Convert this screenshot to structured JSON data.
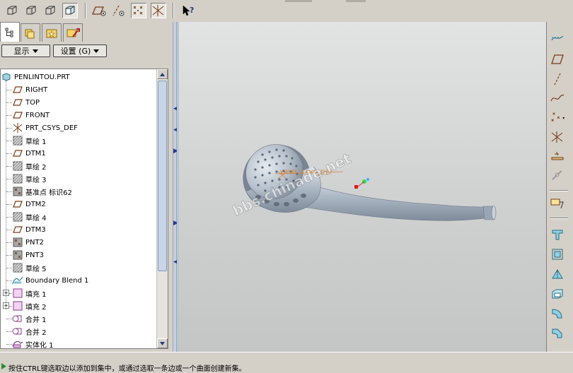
{
  "toolbar": {
    "buttons": [
      {
        "name": "datum-display-icon"
      },
      {
        "name": "hidden-line-icon"
      },
      {
        "name": "no-hidden-icon"
      },
      {
        "name": "shading-icon"
      },
      {
        "name": "plane-display-icon"
      },
      {
        "name": "axis-display-icon"
      },
      {
        "name": "point-display-icon"
      },
      {
        "name": "csys-display-icon"
      },
      {
        "name": "context-help-icon"
      }
    ]
  },
  "panel": {
    "tabs": [
      "model-tree-tab",
      "layer-tree-tab",
      "favorites-tab",
      "connections-tab"
    ],
    "show_label": "显示",
    "settings_label": "设置 (G)"
  },
  "tree": {
    "root": "PENLINTOU.PRT",
    "items": [
      {
        "label": "RIGHT",
        "icon": "plane-icon",
        "expandable": false
      },
      {
        "label": "TOP",
        "icon": "plane-icon",
        "expandable": false
      },
      {
        "label": "FRONT",
        "icon": "plane-icon",
        "expandable": false
      },
      {
        "label": "PRT_CSYS_DEF",
        "icon": "csys-icon",
        "expandable": false
      },
      {
        "label": "草绘 1",
        "icon": "sketch-icon",
        "expandable": false
      },
      {
        "label": "DTM1",
        "icon": "plane-icon",
        "expandable": false
      },
      {
        "label": "草绘 2",
        "icon": "sketch-icon",
        "expandable": false
      },
      {
        "label": "草绘 3",
        "icon": "sketch-icon",
        "expandable": false
      },
      {
        "label": "基准点 标识62",
        "icon": "datum-point-icon",
        "expandable": false
      },
      {
        "label": "DTM2",
        "icon": "plane-icon",
        "expandable": false
      },
      {
        "label": "草绘 4",
        "icon": "sketch-icon",
        "expandable": false
      },
      {
        "label": "DTM3",
        "icon": "plane-icon",
        "expandable": false
      },
      {
        "label": "PNT2",
        "icon": "datum-point-icon",
        "expandable": false
      },
      {
        "label": "PNT3",
        "icon": "datum-point-icon",
        "expandable": false
      },
      {
        "label": "草绘 5",
        "icon": "sketch-icon",
        "expandable": false
      },
      {
        "label": "Boundary Blend 1",
        "icon": "boundary-blend-icon",
        "expandable": false
      },
      {
        "label": "填充 1",
        "icon": "fill-icon",
        "expandable": true
      },
      {
        "label": "填充 2",
        "icon": "fill-icon",
        "expandable": true
      },
      {
        "label": "合并 1",
        "icon": "merge-icon",
        "expandable": false
      },
      {
        "label": "合并 2",
        "icon": "merge-icon",
        "expandable": false
      },
      {
        "label": "实体化 1",
        "icon": "solidify-icon",
        "expandable": false
      }
    ]
  },
  "viewport": {
    "csys_label": "X/PRT_CSYS_DEF",
    "watermark": "bbs.chinade.net"
  },
  "right_toolbar": {
    "buttons": [
      "sketched-curve-icon",
      "datum-plane-icon",
      "datum-axis-icon",
      "datum-curve-icon",
      "datum-point-icon",
      "csys-icon",
      "analysis-icon",
      "view-manager-icon",
      "annotation-icon",
      "trim-icon",
      "offset-icon",
      "draft-icon",
      "shell-icon",
      "round-icon",
      "chamfer-icon"
    ]
  },
  "status": {
    "message": "按住CTRL键选取边以添加到集中，或通过选取一条边或一个曲面创建新集。"
  },
  "colors": {
    "viewport_bg": "#d6d8d8",
    "model": "#b8c2cf",
    "accent": "#223c88"
  }
}
